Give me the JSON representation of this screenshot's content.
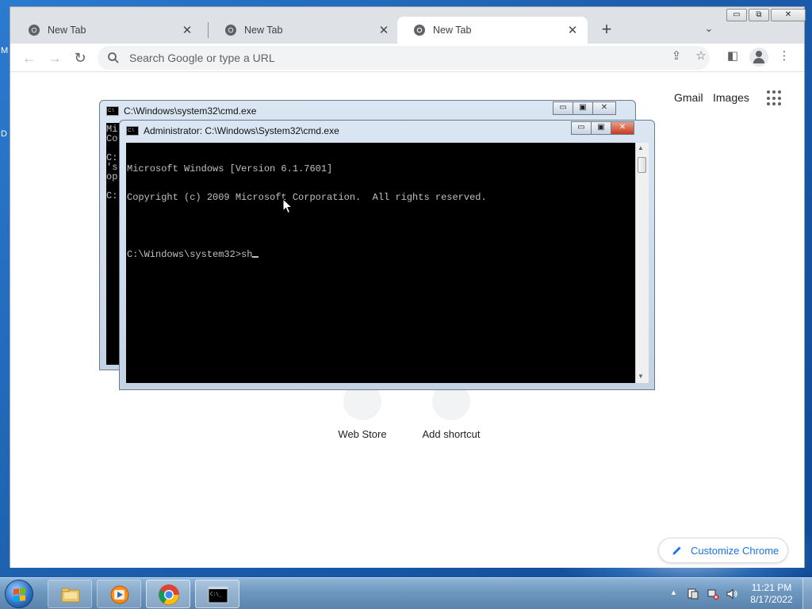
{
  "desktop": {
    "side_labels": [
      "M",
      "D"
    ]
  },
  "chrome": {
    "tabs": [
      {
        "title": "New Tab",
        "active": false
      },
      {
        "title": "New Tab",
        "active": false
      },
      {
        "title": "New Tab",
        "active": true
      }
    ],
    "window_buttons": {
      "minimize": "▭",
      "restore": "⧉",
      "close": "✕"
    },
    "toolbar": {
      "omnibox_placeholder": "Search Google or type a URL"
    },
    "page": {
      "gmail": "Gmail",
      "images": "Images",
      "shortcuts": [
        {
          "label": "Web Store"
        },
        {
          "label": "Add shortcut"
        }
      ],
      "customize_label": "Customize Chrome"
    }
  },
  "cmd_back": {
    "title": "C:\\Windows\\system32\\cmd.exe",
    "lines": [
      "Mi",
      "Co",
      "",
      "C:",
      "'s",
      "op",
      "",
      "C:"
    ]
  },
  "cmd_front": {
    "title": "Administrator: C:\\Windows\\System32\\cmd.exe",
    "lines": [
      "Microsoft Windows [Version 6.1.7601]",
      "Copyright (c) 2009 Microsoft Corporation.  All rights reserved.",
      ""
    ],
    "prompt": "C:\\Windows\\system32>",
    "typed": "sh"
  },
  "taskbar": {
    "apps": [
      {
        "name": "Windows Explorer",
        "icon": "folder-icon",
        "open": false
      },
      {
        "name": "Windows Media Player",
        "icon": "media-player-icon",
        "open": false
      },
      {
        "name": "Google Chrome",
        "icon": "chrome-icon",
        "open": true
      },
      {
        "name": "Command Prompt",
        "icon": "cmd-icon",
        "open": true
      }
    ],
    "clock": {
      "time": "11:21 PM",
      "date": "8/17/2022"
    }
  },
  "colors": {
    "chrome_link_blue": "#1a73e8",
    "console_bg": "#000000",
    "console_fg": "#c0c0c0",
    "cmd_close_red": "#c63b1f"
  }
}
